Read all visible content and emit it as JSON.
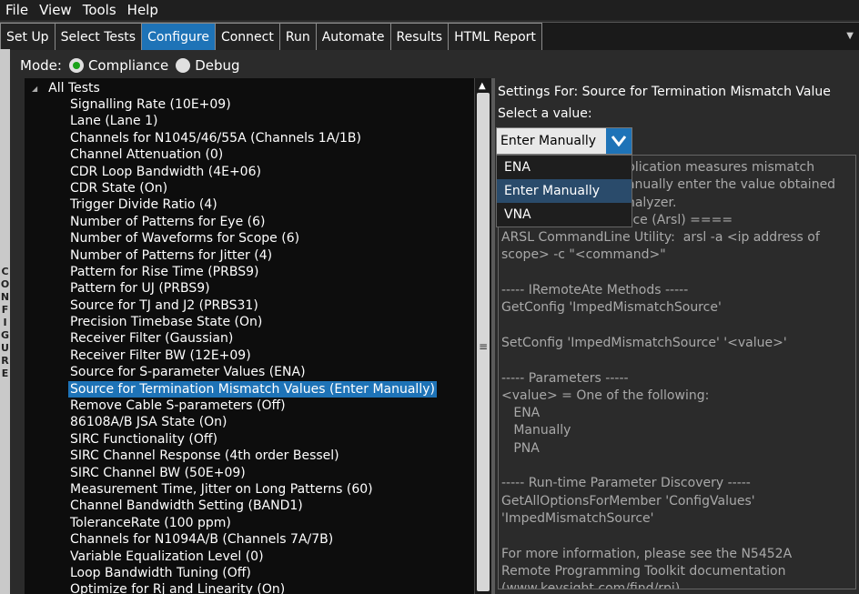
{
  "menu": [
    "File",
    "View",
    "Tools",
    "Help"
  ],
  "tabs": [
    {
      "label": "Set Up",
      "active": false
    },
    {
      "label": "Select Tests",
      "active": false
    },
    {
      "label": "Configure",
      "active": true
    },
    {
      "label": "Connect",
      "active": false
    },
    {
      "label": "Run",
      "active": false
    },
    {
      "label": "Automate",
      "active": false
    },
    {
      "label": "Results",
      "active": false
    },
    {
      "label": "HTML Report",
      "active": false
    }
  ],
  "side_label": "CONFIGURE",
  "mode": {
    "label": "Mode:",
    "options": [
      "Compliance",
      "Debug"
    ],
    "selected": "Compliance"
  },
  "tree": {
    "root": "All Tests",
    "items": [
      "Signalling Rate (10E+09)",
      "Lane (Lane 1)",
      "Channels for N1045/46/55A (Channels 1A/1B)",
      "Channel Attenuation (0)",
      "CDR Loop Bandwidth (4E+06)",
      "CDR State (On)",
      "Trigger Divide Ratio (4)",
      "Number of Patterns for Eye (6)",
      "Number of Waveforms for Scope (6)",
      "Number of Patterns for Jitter (4)",
      "Pattern for Rise Time (PRBS9)",
      "Pattern for UJ (PRBS9)",
      "Source for TJ and J2 (PRBS31)",
      "Precision Timebase State (On)",
      "Receiver Filter (Gaussian)",
      "Receiver Filter BW (12E+09)",
      "Source for S-parameter Values (ENA)",
      "Source for Termination Mismatch Values (Enter Manually)",
      "Remove Cable S-parameters (Off)",
      "86108A/B JSA State (On)",
      "SIRC Functionality (Off)",
      "SIRC Channel Response (4th order Bessel)",
      "SIRC Channel BW (50E+09)",
      "Measurement Time, Jitter on Long Patterns (60)",
      "Channel Bandwidth Setting (BAND1)",
      "ToleranceRate (100 ppm)",
      "Channels for N1094A/B (Channels 7A/7B)",
      "Variable Equalization Level (0)",
      "Loop Bandwidth Tuning (Off)",
      "Optimize for Rj and Linearity (On)"
    ],
    "selected_index": 17
  },
  "settings": {
    "title": "Settings For: Source for Termination Mismatch Value",
    "select_label": "Select a value:",
    "selected_value": "Enter Manually",
    "options": [
      "ENA",
      "Enter Manually",
      "VNA"
    ],
    "highlighted_option": "Enter Manually",
    "info_text": "                               plication measures mismatch\n                               anually enter the value obtained\n                               nalyzer.\n=== Remote Interface (Arsl) ====\nARSL CommandLine Utility:  arsl -a <ip address of\nscope> -c \"<command>\"\n\n----- IRemoteAte Methods -----\nGetConfig 'ImpedMismatchSource'\n\nSetConfig 'ImpedMismatchSource' '<value>'\n\n----- Parameters -----\n<value> = One of the following:\n   ENA\n   Manually\n   PNA\n\n----- Run-time Parameter Discovery -----\nGetAllOptionsForMember 'ConfigValues'\n'ImpedMismatchSource'\n\nFor more information, please see the N5452A\nRemote Programming Toolkit documentation\n(www.keysight.com/find/rpi)."
  },
  "colors": {
    "accent": "#1e73b7",
    "radio_on": "#1aa31a",
    "background": "#2b2b2b"
  }
}
